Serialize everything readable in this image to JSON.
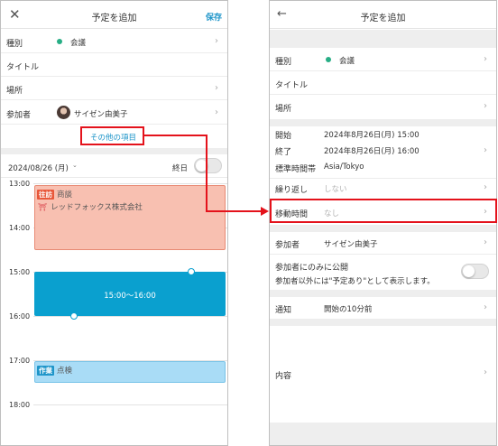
{
  "left": {
    "header": {
      "close_icon": "close-icon",
      "title": "予定を追加",
      "save_label": "保存"
    },
    "rows": {
      "type_label": "種別",
      "type_value": "会議",
      "title_label": "タイトル",
      "place_label": "場所",
      "participants_label": "参加者",
      "participants_value": "サイゼン由美子",
      "more_items": "その他の項目"
    },
    "date": "2024/08/26 (月)",
    "allday_label": "終日",
    "times": [
      "13:00",
      "14:00",
      "15:00",
      "16:00",
      "17:00",
      "18:00"
    ],
    "events": {
      "visit_tag": "往訪",
      "visit_title": "商談",
      "visit_company": "レッドフォックス株式会社",
      "new_event": "15:00〜16:00",
      "work_tag": "作業",
      "work_title": "点検"
    }
  },
  "right": {
    "header": {
      "back_icon": "back-arrow-icon",
      "title": "予定を追加"
    },
    "rows": {
      "type_label": "種別",
      "type_value": "会議",
      "title_label": "タイトル",
      "place_label": "場所",
      "start_label": "開始",
      "start_value": "2024年8月26日(月) 15:00",
      "end_label": "終了",
      "end_value": "2024年8月26日(月) 16:00",
      "tz_label": "標準時間帯",
      "tz_value": "Asia/Tokyo",
      "repeat_label": "繰り返し",
      "repeat_value": "しない",
      "travel_label": "移動時間",
      "travel_value": "なし",
      "participants_label": "参加者",
      "participants_value": "サイゼン由美子",
      "public_label": "参加者にのみに公開",
      "public_note": "参加者以外には\"予定あり\"として表示します。",
      "notify_label": "通知",
      "notify_value": "開始の10分前",
      "content_label": "内容"
    }
  },
  "colors": {
    "accent": "#1e95c9",
    "highlight": "#e4121b",
    "visit": "#f8c0b1",
    "selected": "#0aa0cf",
    "work": "#a9dcf6"
  }
}
